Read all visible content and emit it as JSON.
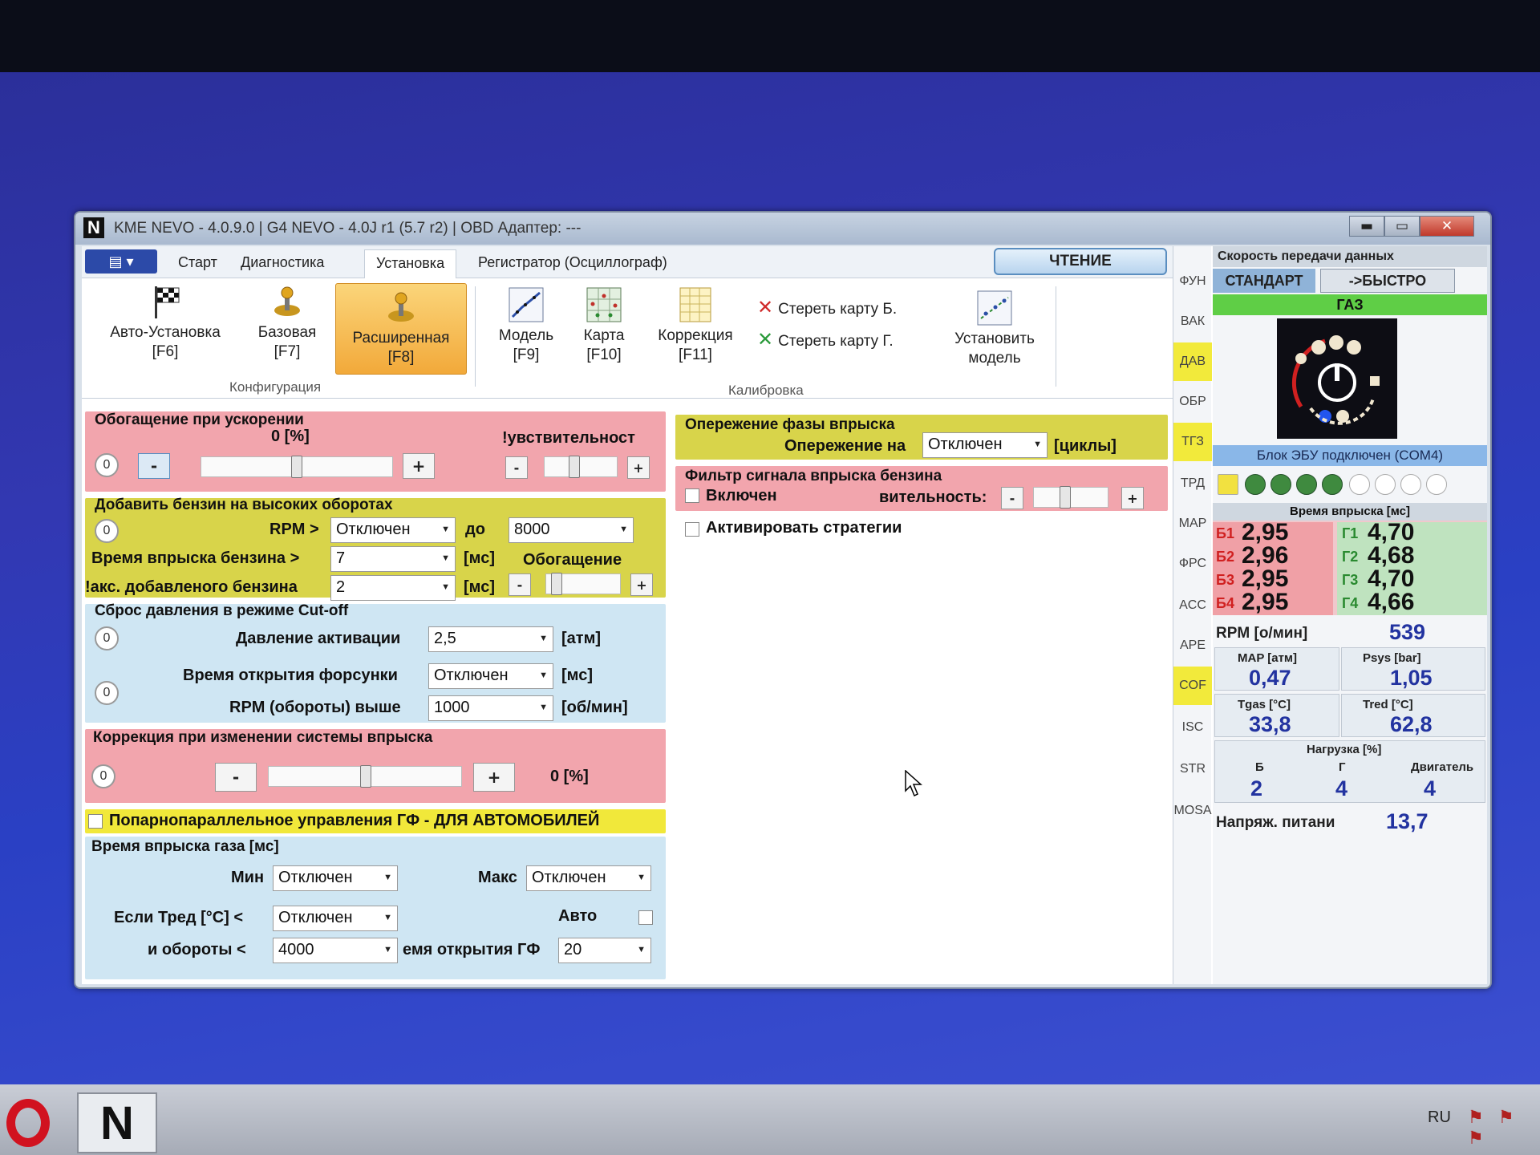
{
  "window": {
    "logo": "N",
    "title": "KME NEVO - 4.0.9.0  |  G4 NEVO - 4.0J r1 (5.7 r2)  |  OBD Адаптер: ---",
    "btn_min": "▬",
    "btn_max": "▭",
    "btn_close": "✕"
  },
  "tabs": {
    "menu": "▤ ▾",
    "items": [
      "Старт",
      "Диагностика",
      "Установка",
      "Регистратор (Осциллограф)"
    ],
    "active": "Установка",
    "read_button": "ЧТЕНИЕ"
  },
  "ribbon": {
    "config_buttons": [
      {
        "line1": "Авто-Установка",
        "line2": "[F6]",
        "icon": "checkered-flag-icon"
      },
      {
        "line1": "Базовая",
        "line2": "[F7]",
        "icon": "joystick-icon"
      },
      {
        "line1": "Расширенная",
        "line2": "[F8]",
        "icon": "joystick-icon"
      }
    ],
    "config_group": "Конфигурация",
    "calib_buttons": [
      {
        "line1": "Модель",
        "line2": "[F9]",
        "icon": "model-graph-icon"
      },
      {
        "line1": "Карта",
        "line2": "[F10]",
        "icon": "map-grid-icon"
      },
      {
        "line1": "Коррекция",
        "line2": "[F11]",
        "icon": "correction-table-icon"
      }
    ],
    "erase_b": "Стереть карту Б.",
    "erase_g": "Стереть карту Г.",
    "set_model_line1": "Установить",
    "set_model_line2": "модель",
    "calib_group": "Калибровка"
  },
  "accel_enrich": {
    "title": "Обогащение при ускорении",
    "value": "0  [%]",
    "reset": "0",
    "minus": "-",
    "plus": "+",
    "sensitivity_label": "!увствительност",
    "s_minus": "-",
    "s_plus": "+"
  },
  "high_rpm": {
    "title": "Добавить бензин на высоких оборотах",
    "reset": "0",
    "rpm_label": "RPM >",
    "rpm_value": "Отключен",
    "to_label": "до",
    "to_value": "8000",
    "time_label": "Время впрыска бензина >",
    "time_value": "7",
    "time_unit": "[мс]",
    "enrich_label": "Обогащение",
    "max_label": "!акс. добавленого бензина",
    "max_value": "2",
    "max_unit": "[мс]",
    "e_minus": "-",
    "e_plus": "+"
  },
  "cutoff": {
    "title": "Сброс давления в режиме Cut-off",
    "reset1": "0",
    "pressure_label": "Давление активации",
    "pressure_value": "2,5",
    "pressure_unit": "[атм]",
    "reset2": "0",
    "open_label": "Время открытия форсунки",
    "open_value": "Отключен",
    "open_unit": "[мс]",
    "rpm_label": "RPM (обороты) выше",
    "rpm_value": "1000",
    "rpm_unit": "[об/мин]"
  },
  "inj_correction": {
    "title": "Коррекция при изменении системы впрыска",
    "reset": "0",
    "minus": "-",
    "plus": "+",
    "value": "0  [%]"
  },
  "paired": {
    "label": "Попарнопараллельное управления ГФ - ДЛЯ АВТОМОБИЛЕЙ"
  },
  "gas_time": {
    "title": "Время впрыска газа [мс]",
    "min_label": "Мин",
    "min_value": "Отключен",
    "max_label": "Макс",
    "max_value": "Отключен",
    "tred_label": "Если Тред [°C] <",
    "tred_value": "Отключен",
    "auto_label": "Авто",
    "rpm_label": "и обороты <",
    "rpm_value": "4000",
    "open_label": "емя открытия ГФ",
    "open_value": "20"
  },
  "phase_advance": {
    "title": "Опережение фазы впрыска",
    "label": "Опережение на",
    "value": "Отключен",
    "unit": "[циклы]"
  },
  "petrol_filter": {
    "title": "Фильтр сигнала впрыска бензина",
    "enabled_label": "Включен",
    "sens_label": "вительность:",
    "minus": "-",
    "plus": "+"
  },
  "strategies": {
    "label": "Активировать стратегии"
  },
  "vtabs": [
    "ФУН",
    "ВАК",
    "ДАВ",
    "ОБР",
    "ТГЗ",
    "ТРД",
    "MAP",
    "ФРС",
    "ACC",
    "APE",
    "COF",
    "ISC",
    "STR",
    "MOSA"
  ],
  "vtabs_highlighted": [
    "ДАВ",
    "ТГЗ",
    "COF"
  ],
  "right_panel": {
    "speed_header": "Скорость передачи данных",
    "standard": "СТАНДАРТ",
    "fast": "->БЫСТРО",
    "gas_label": "ГАЗ",
    "ecu_status": "Блок ЭБУ подключен (COM4)",
    "leds_on": 4,
    "leds_total": 9,
    "inj_header": "Время впрыска [мс]",
    "petrol": [
      {
        "tag": "Б1",
        "value": "2,95"
      },
      {
        "tag": "Б2",
        "value": "2,96"
      },
      {
        "tag": "Б3",
        "value": "2,95"
      },
      {
        "tag": "Б4",
        "value": "2,95"
      }
    ],
    "gas": [
      {
        "tag": "Г1",
        "value": "4,70"
      },
      {
        "tag": "Г2",
        "value": "4,68"
      },
      {
        "tag": "Г3",
        "value": "4,70"
      },
      {
        "tag": "Г4",
        "value": "4,66"
      }
    ],
    "rpm_label": "RPM [о/мин]",
    "rpm_value": "539",
    "map_label": "MAP [атм]",
    "map_value": "0,47",
    "psys_label": "Psys [bar]",
    "psys_value": "1,05",
    "tgas_label": "Tgas [°C]",
    "tgas_value": "33,8",
    "tred_label": "Tred [°C]",
    "tred_value": "62,8",
    "load_header": "Нагрузка [%]",
    "load_b_label": "Б",
    "load_b_value": "2",
    "load_g_label": "Г",
    "load_g_value": "4",
    "load_engine_label": "Двигатель",
    "load_engine_value": "4",
    "voltage_label": "Напряж. питани",
    "voltage_value": "13,7"
  },
  "taskbar": {
    "nevo_label": "N",
    "lang": "RU",
    "tray": "⚑ ⚑ ⚑"
  },
  "colors": {
    "pink_panel": "#f2a5ad",
    "yellow_panel": "#d8d44a",
    "blue_panel": "#cfe6f3",
    "active_ribbon": "#f2a93a",
    "gas_green": "#5fce46"
  }
}
